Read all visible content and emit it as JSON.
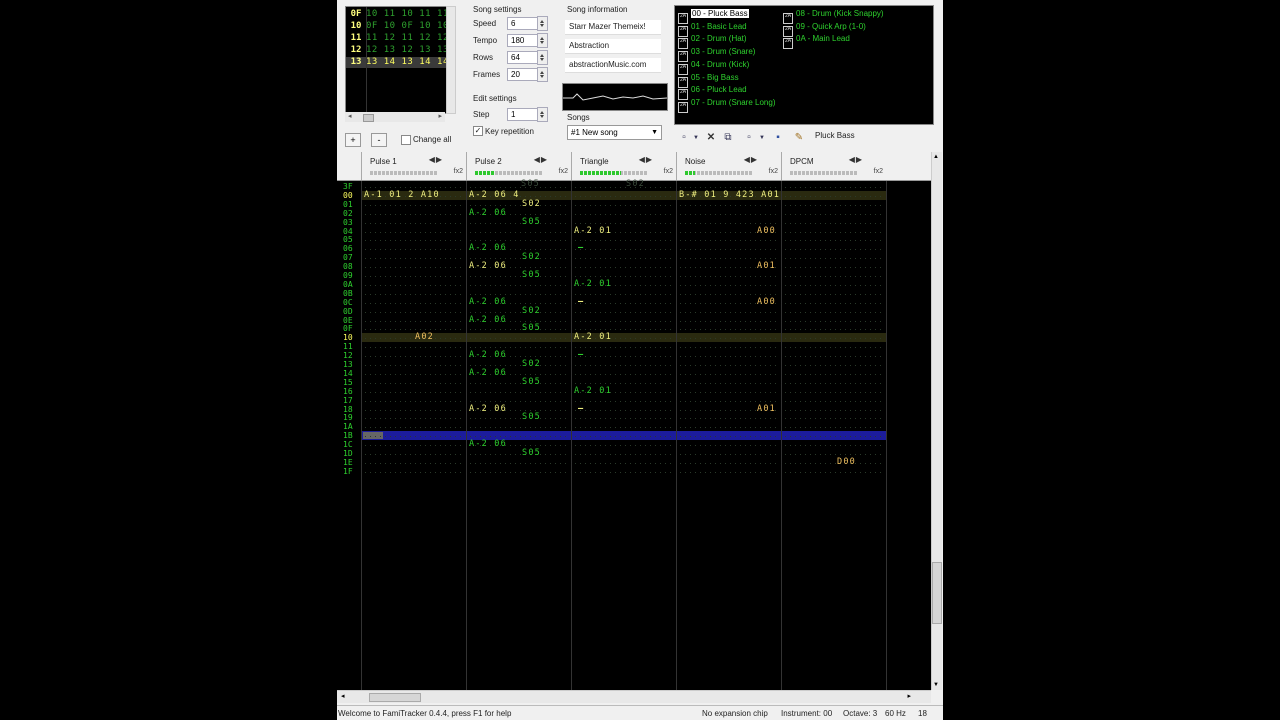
{
  "frames": {
    "rows": [
      {
        "num": "0F",
        "cells": "10 11 10 11 11"
      },
      {
        "num": "10",
        "cells": "0F 10 0F 10 10"
      },
      {
        "num": "11",
        "cells": "11 12 11 12 12"
      },
      {
        "num": "12",
        "cells": "12 13 12 13 13"
      },
      {
        "num": "13",
        "cells": "13 14 13 14 14"
      }
    ],
    "selected_index": 4,
    "add_label": "+",
    "remove_label": "-",
    "change_all_label": "Change all"
  },
  "song_settings": {
    "title": "Song settings",
    "speed_label": "Speed",
    "speed": "6",
    "tempo_label": "Tempo",
    "tempo": "180",
    "rows_label": "Rows",
    "rows": "64",
    "frames_label": "Frames",
    "frames": "20"
  },
  "edit_settings": {
    "title": "Edit settings",
    "step_label": "Step",
    "step": "1",
    "key_repetition_label": "Key repetition",
    "key_repetition_checked": true
  },
  "song_information": {
    "title": "Song information",
    "name": "Starr Mazer Themeix!",
    "artist": "Abstraction",
    "copyright": "abstractionMusic.com"
  },
  "songs": {
    "label": "Songs",
    "selected": "#1 New song"
  },
  "instruments": {
    "items": [
      {
        "label": "00 - Pluck Bass"
      },
      {
        "label": "01 - Basic Lead"
      },
      {
        "label": "02 - Drum (Hat)"
      },
      {
        "label": "03 - Drum (Snare)"
      },
      {
        "label": "04 - Drum (Kick)"
      },
      {
        "label": "05 - Big Bass"
      },
      {
        "label": "06 - Pluck Lead"
      },
      {
        "label": "07 - Drum (Snare Long)"
      },
      {
        "label": "08 - Drum (Kick Snappy)"
      },
      {
        "label": "09 - Quick Arp (1-0)"
      },
      {
        "label": "0A - Main Lead"
      }
    ],
    "selected_index": 0,
    "icon_text": "2A",
    "name_field": "Pluck Bass"
  },
  "channels": [
    {
      "name": "Pulse 1",
      "fx": "fx2",
      "level": 0
    },
    {
      "name": "Pulse 2",
      "fx": "fx2",
      "level": 0.3
    },
    {
      "name": "Triangle",
      "fx": "fx2",
      "level": 0.6
    },
    {
      "name": "Noise",
      "fx": "fx2",
      "level": 0.15
    },
    {
      "name": "DPCM",
      "fx": "fx2",
      "level": 0
    }
  ],
  "pattern": {
    "row_numbers": [
      "3F",
      "00",
      "01",
      "02",
      "03",
      "04",
      "05",
      "06",
      "07",
      "08",
      "09",
      "0A",
      "0B",
      "0C",
      "0D",
      "0E",
      "0F",
      "10",
      "11",
      "12",
      "13",
      "14",
      "15",
      "16",
      "17",
      "18",
      "19",
      "1A",
      "1B",
      "1C",
      "1D",
      "1E",
      "1F"
    ],
    "highlight_rows": [
      1,
      17
    ],
    "cursor_row": 28,
    "ghost_row0": [
      "S05",
      "S02"
    ],
    "cells": [
      {
        "row": 1,
        "col": 0,
        "part": "note",
        "text": "A-1 01 2 A10",
        "color": "#f0f080"
      },
      {
        "row": 1,
        "col": 1,
        "part": "note",
        "text": "A-2 06 4",
        "color": "#f0f080"
      },
      {
        "row": 1,
        "col": 3,
        "part": "note",
        "text": "B-# 01 9 423 A01",
        "color": "#f0f080"
      },
      {
        "row": 2,
        "col": 1,
        "part": "fx",
        "text": "S02",
        "color": "#f0f080"
      },
      {
        "row": 3,
        "col": 1,
        "part": "note",
        "text": "A-2 06",
        "color": "#2ed12e"
      },
      {
        "row": 4,
        "col": 1,
        "part": "fx",
        "text": "S05",
        "color": "#2ed12e"
      },
      {
        "row": 5,
        "col": 2,
        "part": "note",
        "text": "A-2 01",
        "color": "#f0f080"
      },
      {
        "row": 5,
        "col": 3,
        "part": "fx",
        "text": "A00",
        "color": "#f0c060"
      },
      {
        "row": 7,
        "col": 1,
        "part": "note",
        "text": "A-2 06",
        "color": "#2ed12e"
      },
      {
        "row": 7,
        "col": 2,
        "part": "note",
        "text": "—",
        "color": "#2ed12e"
      },
      {
        "row": 8,
        "col": 1,
        "part": "fx",
        "text": "S02",
        "color": "#2ed12e"
      },
      {
        "row": 9,
        "col": 1,
        "part": "note",
        "text": "A-2 06",
        "color": "#f0f080"
      },
      {
        "row": 9,
        "col": 3,
        "part": "fx",
        "text": "A01",
        "color": "#f0c060"
      },
      {
        "row": 10,
        "col": 1,
        "part": "fx",
        "text": "S05",
        "color": "#2ed12e"
      },
      {
        "row": 11,
        "col": 2,
        "part": "note",
        "text": "A-2 01",
        "color": "#2ed12e"
      },
      {
        "row": 13,
        "col": 1,
        "part": "note",
        "text": "A-2 06",
        "color": "#2ed12e"
      },
      {
        "row": 13,
        "col": 2,
        "part": "note",
        "text": "—",
        "color": "#f0f080"
      },
      {
        "row": 13,
        "col": 3,
        "part": "fx",
        "text": "A00",
        "color": "#f0c060"
      },
      {
        "row": 14,
        "col": 1,
        "part": "fx",
        "text": "S02",
        "color": "#2ed12e"
      },
      {
        "row": 15,
        "col": 1,
        "part": "note",
        "text": "A-2 06",
        "color": "#2ed12e"
      },
      {
        "row": 16,
        "col": 1,
        "part": "fx",
        "text": "S05",
        "color": "#2ed12e"
      },
      {
        "row": 17,
        "col": 0,
        "part": "fx",
        "text": "A02",
        "color": "#f0c060"
      },
      {
        "row": 17,
        "col": 2,
        "part": "note",
        "text": "A-2 01",
        "color": "#f0f080"
      },
      {
        "row": 19,
        "col": 1,
        "part": "note",
        "text": "A-2 06",
        "color": "#2ed12e"
      },
      {
        "row": 19,
        "col": 2,
        "part": "note",
        "text": "—",
        "color": "#2ed12e"
      },
      {
        "row": 20,
        "col": 1,
        "part": "fx",
        "text": "S02",
        "color": "#2ed12e"
      },
      {
        "row": 21,
        "col": 1,
        "part": "note",
        "text": "A-2 06",
        "color": "#2ed12e"
      },
      {
        "row": 22,
        "col": 1,
        "part": "fx",
        "text": "S05",
        "color": "#2ed12e"
      },
      {
        "row": 23,
        "col": 2,
        "part": "note",
        "text": "A-2 01",
        "color": "#2ed12e"
      },
      {
        "row": 25,
        "col": 1,
        "part": "note",
        "text": "A-2 06",
        "color": "#f0f080"
      },
      {
        "row": 25,
        "col": 2,
        "part": "note",
        "text": "—",
        "color": "#f0f080"
      },
      {
        "row": 25,
        "col": 3,
        "part": "fx",
        "text": "A01",
        "color": "#f0c060"
      },
      {
        "row": 26,
        "col": 1,
        "part": "fx",
        "text": "S05",
        "color": "#2ed12e"
      },
      {
        "row": 29,
        "col": 1,
        "part": "note",
        "text": "A-2 06",
        "color": "#2ed12e"
      },
      {
        "row": 30,
        "col": 1,
        "part": "fx",
        "text": "S05",
        "color": "#2ed12e"
      },
      {
        "row": 31,
        "col": 4,
        "part": "fx",
        "text": "D00",
        "color": "#f0c060"
      }
    ]
  },
  "status": {
    "message": "Welcome to FamiTracker 0.4.4, press F1 for help",
    "chip": "No expansion chip",
    "instrument": "Instrument: 00",
    "octave": "Octave: 3",
    "rate": "60 Hz",
    "tempo": "18"
  },
  "colors": {
    "pattern_bg": "#000000",
    "note_green": "#2ed12e",
    "note_yellow": "#f0f080",
    "cursor_row": "#1c1c9c"
  }
}
